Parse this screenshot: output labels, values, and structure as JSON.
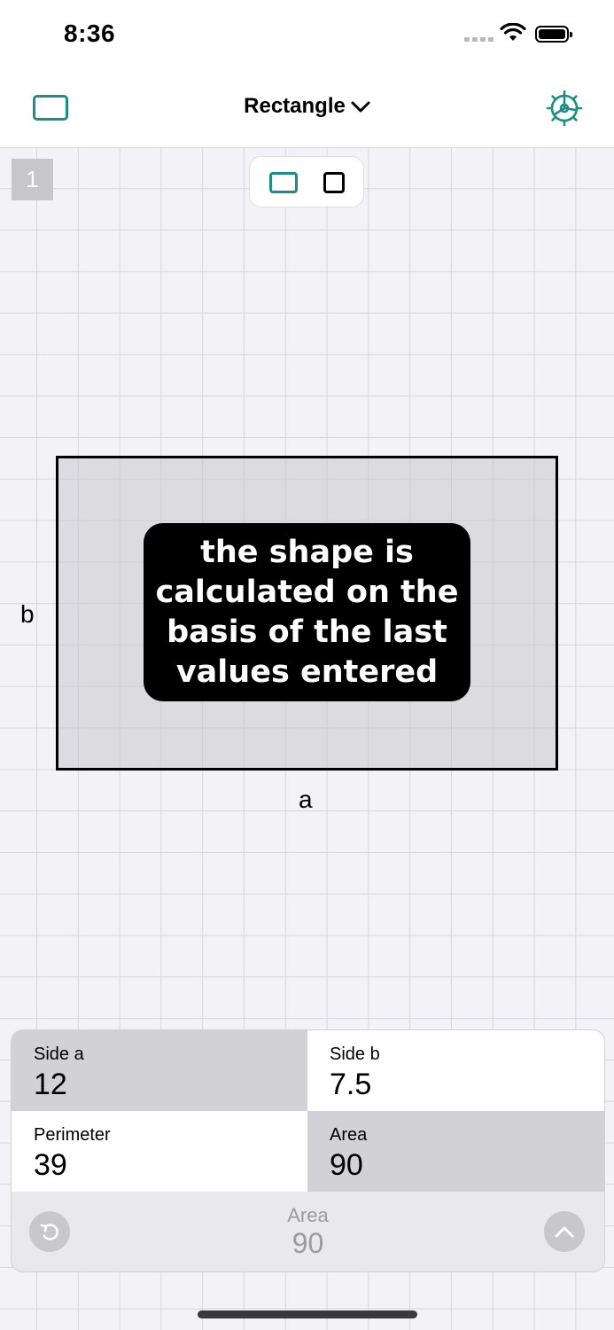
{
  "status_bar": {
    "time": "8:36"
  },
  "nav": {
    "title": "Rectangle",
    "left_icon": "rectangle-icon",
    "right_icon": "settings-gear-icon",
    "accent_color": "#1a8f86"
  },
  "canvas": {
    "page_number": "1",
    "segments": [
      {
        "icon": "rectangle-shape-icon",
        "selected": true
      },
      {
        "icon": "square-shape-icon",
        "selected": false
      }
    ],
    "side_a_label": "a",
    "side_b_label": "b",
    "tooltip": "the shape is calculated on the basis of the last values entered"
  },
  "panel": {
    "cells": [
      {
        "label": "Side a",
        "value": "12"
      },
      {
        "label": "Side b",
        "value": "7.5"
      },
      {
        "label": "Perimeter",
        "value": "39"
      },
      {
        "label": "Area",
        "value": "90"
      }
    ],
    "footer": {
      "label": "Area",
      "value": "90"
    }
  }
}
